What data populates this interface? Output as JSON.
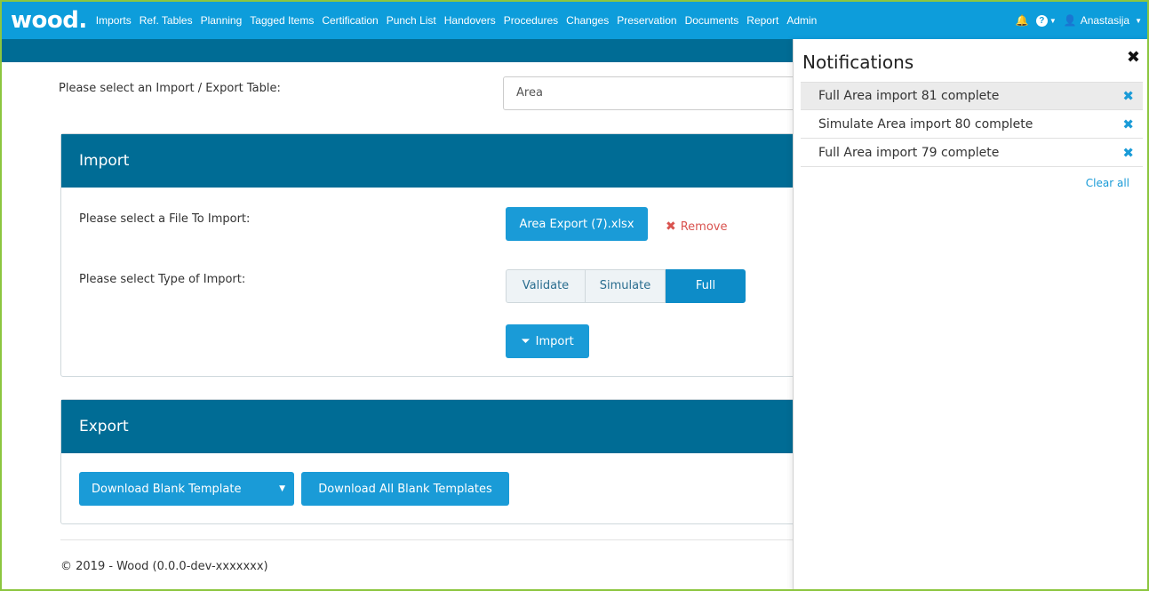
{
  "nav": {
    "logo": "wood",
    "logo_dot": ".",
    "items": [
      "Imports",
      "Ref. Tables",
      "Planning",
      "Tagged Items",
      "Certification",
      "Punch List",
      "Handovers",
      "Procedures",
      "Changes",
      "Preservation",
      "Documents",
      "Report",
      "Admin"
    ],
    "user": "Anastasija",
    "help": "?"
  },
  "page": {
    "select_label": "Please select an Import / Export Table:",
    "select_value": "Area"
  },
  "import": {
    "title": "Import",
    "file_label": "Please select a File To Import:",
    "file_button": "Area Export (7).xlsx",
    "remove_label": "Remove",
    "type_label": "Please select Type of Import:",
    "types": [
      "Validate",
      "Simulate",
      "Full"
    ],
    "active_type": "Full",
    "import_button": "Import"
  },
  "export": {
    "title": "Export",
    "download_template": "Download Blank Template",
    "download_all": "Download All Blank Templates"
  },
  "footer": {
    "text": "© 2019 - Wood (0.0.0-dev-xxxxxxx)"
  },
  "notifications": {
    "title": "Notifications",
    "items": [
      "Full Area import 81 complete",
      "Simulate Area import 80 complete",
      "Full Area import 79 complete"
    ],
    "clear_all": "Clear all"
  },
  "colors": {
    "nav_bg": "#0d9ddb",
    "header_bg": "#006c95",
    "primary": "#1a9bd7",
    "danger": "#d9534f",
    "frame": "#8cc63f"
  }
}
